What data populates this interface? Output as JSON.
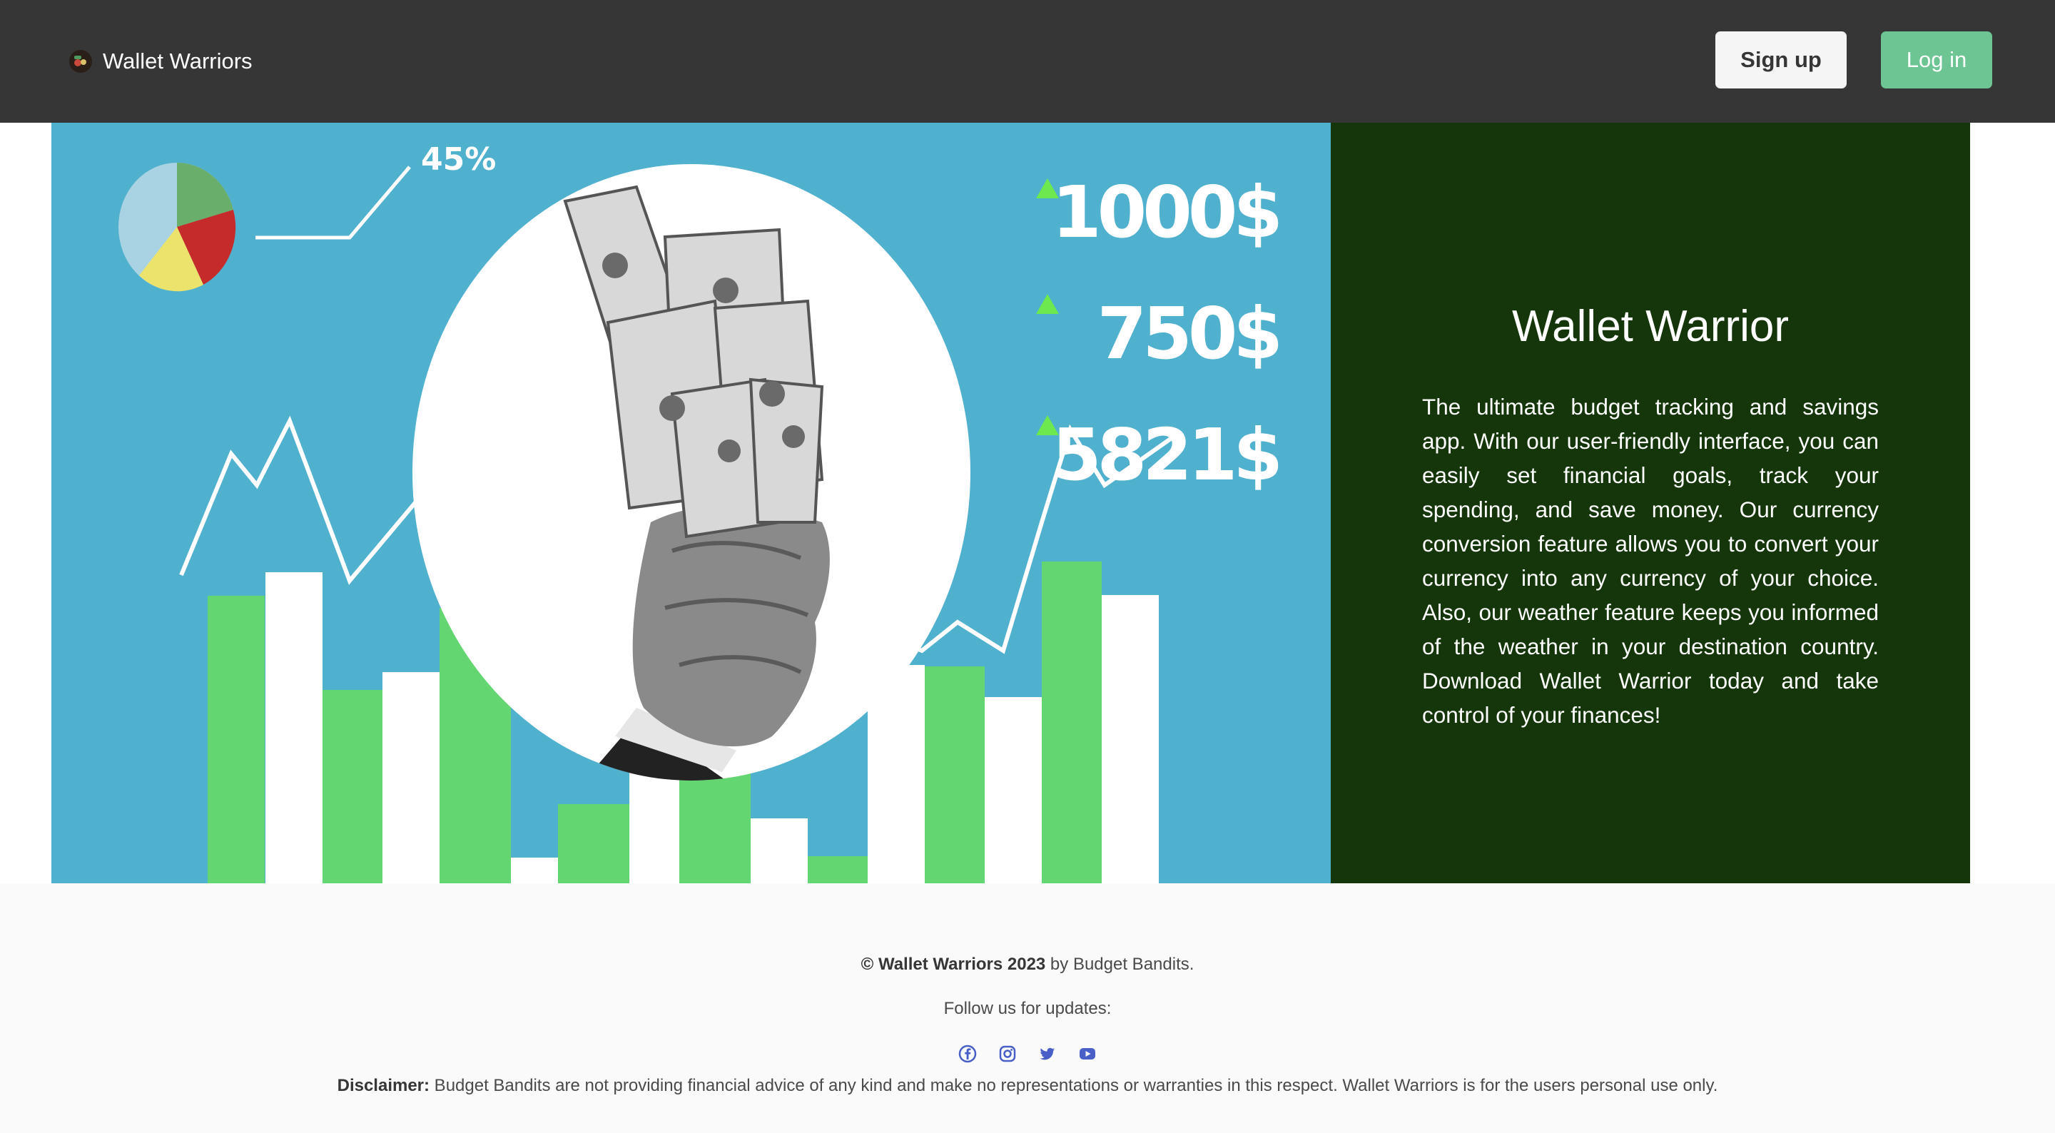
{
  "navbar": {
    "brand_name": "Wallet Warriors",
    "signup_label": "Sign up",
    "login_label": "Log in"
  },
  "hero": {
    "graphic": {
      "pie_percent_label": "45%",
      "stats": [
        "1000$",
        "750$",
        "5821$"
      ]
    },
    "title": "Wallet Warrior",
    "description": "The ultimate budget tracking and savings app. With our user-friendly interface, you can easily set financial goals, track your spending, and save money. Our currency conversion feature allows you to convert your currency into any currency of your choice. Also, our weather feature keeps you informed of the weather in your destination country. Download Wallet Warrior today and take control of your finances!"
  },
  "footer": {
    "copyright": "© Wallet Warriors 2023",
    "by_text": " by Budget Bandits.",
    "follow_text": "Follow us for updates:",
    "social_icons": [
      "facebook-icon",
      "instagram-icon",
      "twitter-icon",
      "youtube-icon"
    ],
    "disclaimer_label": "Disclaimer:",
    "disclaimer_text": " Budget Bandits are not providing financial advice of any kind and make no representations or warranties in this respect. Wallet Warriors is for the users personal use only."
  },
  "colors": {
    "navbar": "#363636",
    "login_button": "#6cc592",
    "hero_background": "#50b1cf",
    "hero_panel": "#14360a",
    "bar_green": "#63d571",
    "arrow_green": "#6ee84f",
    "footer_background": "#fafafa",
    "social_icon": "#485fc7"
  }
}
